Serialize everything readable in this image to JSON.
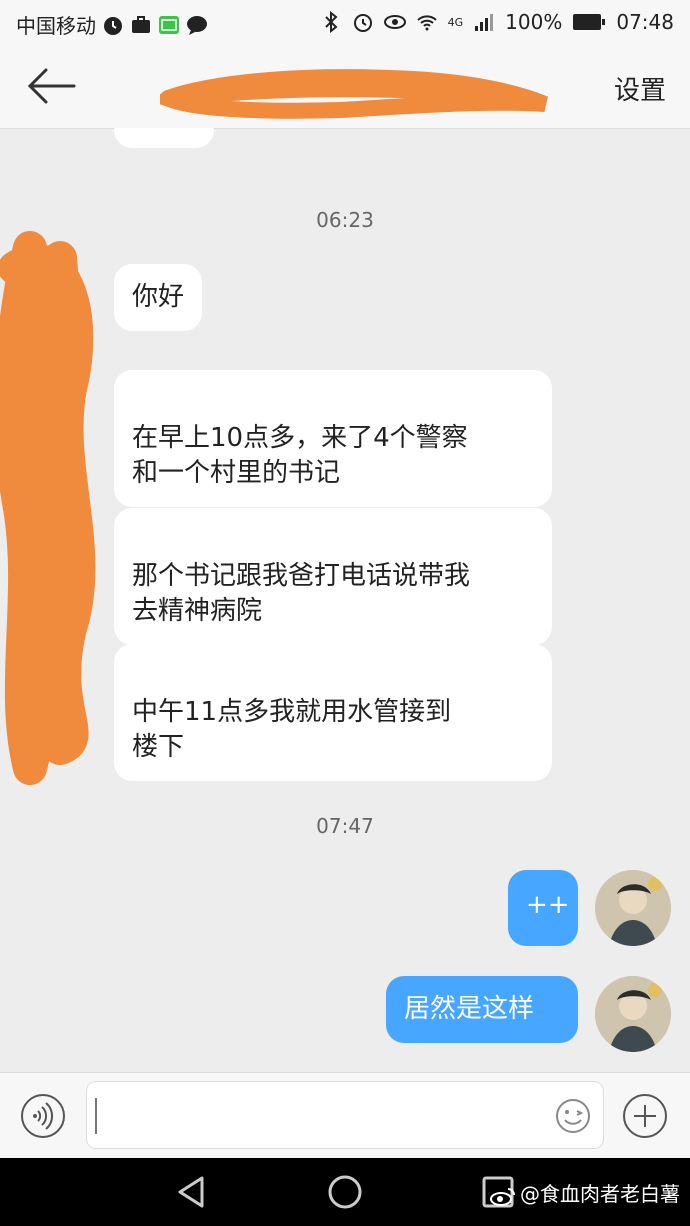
{
  "status_bar": {
    "carrier": "中国移动",
    "network": "4G",
    "battery": "100%",
    "time": "07:48"
  },
  "header": {
    "settings_label": "设置"
  },
  "chat": {
    "timestamps": [
      "06:23",
      "07:47"
    ],
    "incoming": [
      {
        "text": "你好"
      },
      {
        "text": "在早上10点多，来了4个警察\n和一个村里的书记"
      },
      {
        "text": "那个书记跟我爸打电话说带我\n去精神病院"
      },
      {
        "text": "中午11点多我就用水管接到\n楼下"
      }
    ],
    "outgoing": [
      {
        "text": "++"
      },
      {
        "text": "居然是这样"
      }
    ]
  },
  "input": {
    "value": ""
  },
  "watermark": {
    "text": "@食血肉者老白薯"
  },
  "colors": {
    "outgoing_bubble": "#47a6ff",
    "incoming_bubble": "#ffffff",
    "scribble": "#f08a3c"
  }
}
